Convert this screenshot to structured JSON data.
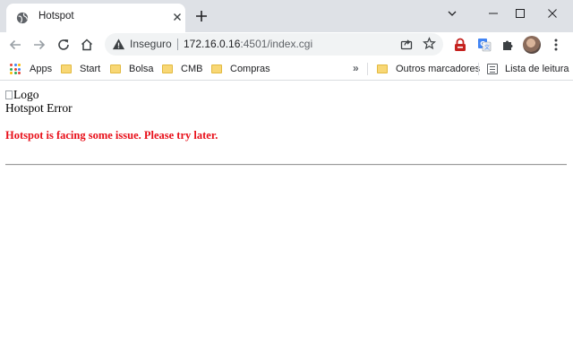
{
  "tab": {
    "title": "Hotspot"
  },
  "address_bar": {
    "security_label": "Inseguro",
    "url_host": "172.16.0.16",
    "url_rest": ":4501/index.cgi"
  },
  "bookmarks": {
    "items": [
      {
        "label": "Apps",
        "icon": "apps-grid-icon"
      },
      {
        "label": "Start",
        "icon": "folder-icon"
      },
      {
        "label": "Bolsa",
        "icon": "folder-icon"
      },
      {
        "label": "CMB",
        "icon": "folder-icon"
      },
      {
        "label": "Compras",
        "icon": "folder-icon"
      }
    ],
    "overflow_label": "»",
    "other_bookmarks": "Outros marcadores",
    "reading_list": "Lista de leitura"
  },
  "page": {
    "logo_alt": "Logo",
    "title": "Hotspot Error",
    "error_message": "Hotspot is facing some issue. Please try later."
  },
  "colors": {
    "error_text": "#e8101a",
    "tab_strip": "#dee1e6",
    "omnibox": "#f1f3f4"
  }
}
